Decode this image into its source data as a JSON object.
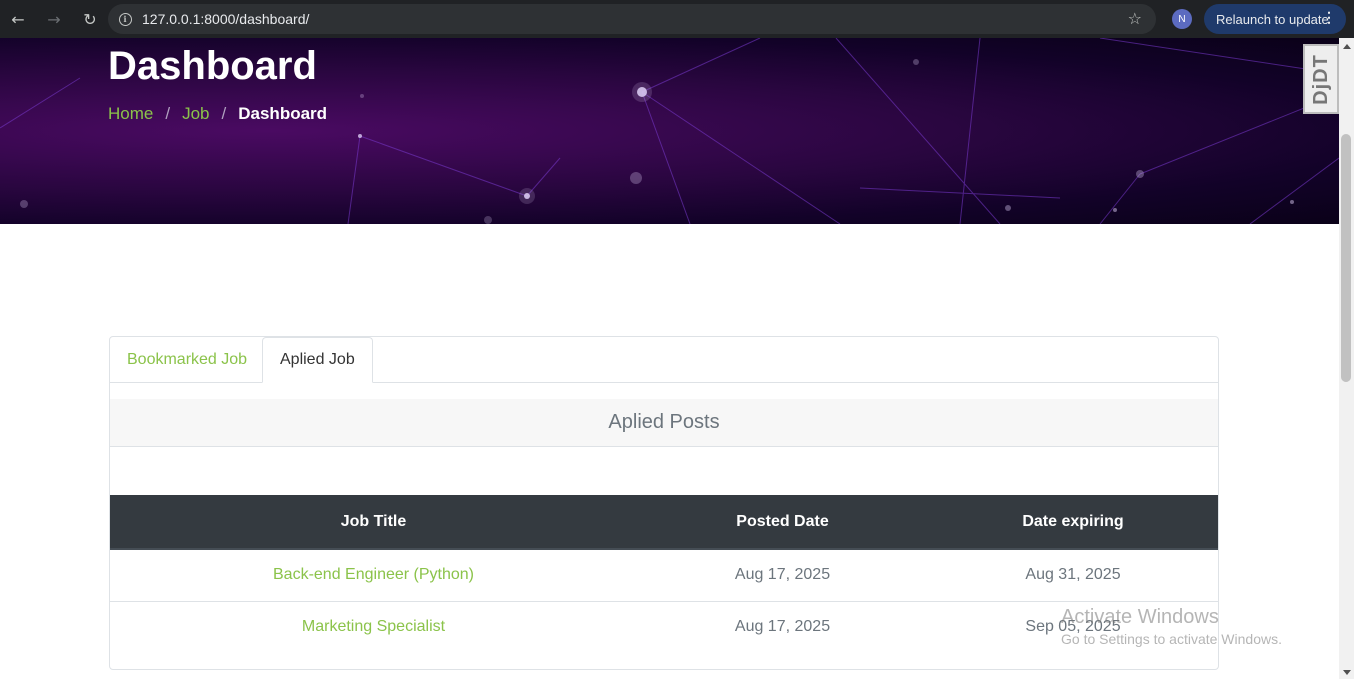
{
  "browser": {
    "url": "127.0.0.1:8000/dashboard/",
    "profile_initial": "N",
    "relaunch_label": "Relaunch to update",
    "icons": [
      "back-arrow-icon",
      "forward-arrow-icon",
      "reload-icon",
      "site-info-icon",
      "bookmark-star-icon",
      "menu-dots-icon"
    ]
  },
  "hero": {
    "title": "Dashboard",
    "breadcrumb": {
      "home": "Home",
      "job": "Job",
      "current": "Dashboard",
      "separator": "/"
    }
  },
  "debug_toolbar": {
    "label": "DjDT"
  },
  "tabs": {
    "bookmarked": "Bookmarked Job",
    "applied": "Aplied Job",
    "active": "applied"
  },
  "applied": {
    "heading": "Aplied Posts",
    "columns": [
      "Job Title",
      "Posted Date",
      "Date expiring"
    ],
    "rows": [
      {
        "title": "Back-end Engineer (Python)",
        "posted": "Aug 17, 2025",
        "expiring": "Aug 31, 2025"
      },
      {
        "title": "Marketing Specialist",
        "posted": "Aug 17, 2025",
        "expiring": "Sep 05, 2025"
      }
    ]
  },
  "watermark": {
    "line1": "Activate Windows",
    "line2": "Go to Settings to activate Windows."
  },
  "colors": {
    "accent_green": "#8bc34a",
    "table_header": "#343a40",
    "hero_purple": "#2a0640"
  }
}
